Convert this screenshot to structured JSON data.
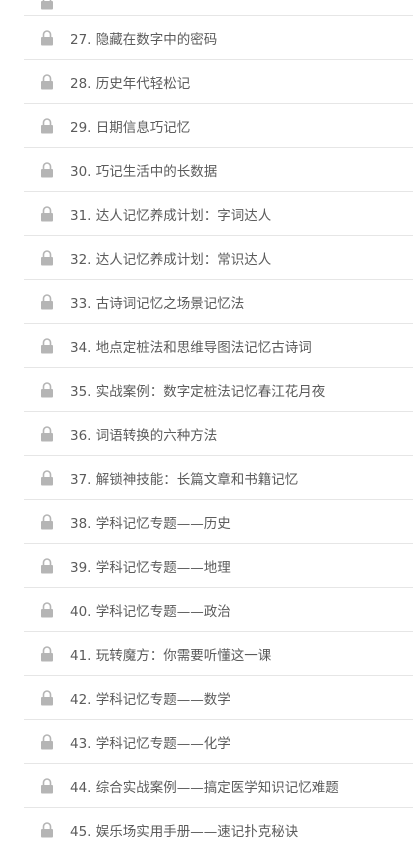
{
  "lessons": [
    {
      "label": ""
    },
    {
      "label": "27. 隐藏在数字中的密码"
    },
    {
      "label": "28. 历史年代轻松记"
    },
    {
      "label": "29. 日期信息巧记忆"
    },
    {
      "label": "30. 巧记生活中的长数据"
    },
    {
      "label": "31. 达人记忆养成计划：字词达人"
    },
    {
      "label": "32. 达人记忆养成计划：常识达人"
    },
    {
      "label": "33. 古诗词记忆之场景记忆法"
    },
    {
      "label": "34. 地点定桩法和思维导图法记忆古诗词"
    },
    {
      "label": "35. 实战案例：数字定桩法记忆春江花月夜"
    },
    {
      "label": "36. 词语转换的六种方法"
    },
    {
      "label": "37. 解锁神技能：长篇文章和书籍记忆"
    },
    {
      "label": "38. 学科记忆专题——历史"
    },
    {
      "label": "39. 学科记忆专题——地理"
    },
    {
      "label": "40. 学科记忆专题——政治"
    },
    {
      "label": "41. 玩转魔方：你需要听懂这一课"
    },
    {
      "label": "42. 学科记忆专题——数学"
    },
    {
      "label": "43. 学科记忆专题——化学"
    },
    {
      "label": "44. 综合实战案例——搞定医学知识记忆难题"
    },
    {
      "label": "45. 娱乐场实用手册——速记扑克秘诀"
    }
  ],
  "icons": {
    "lock": "lock-icon",
    "lock_color": "#b5b5b5"
  }
}
